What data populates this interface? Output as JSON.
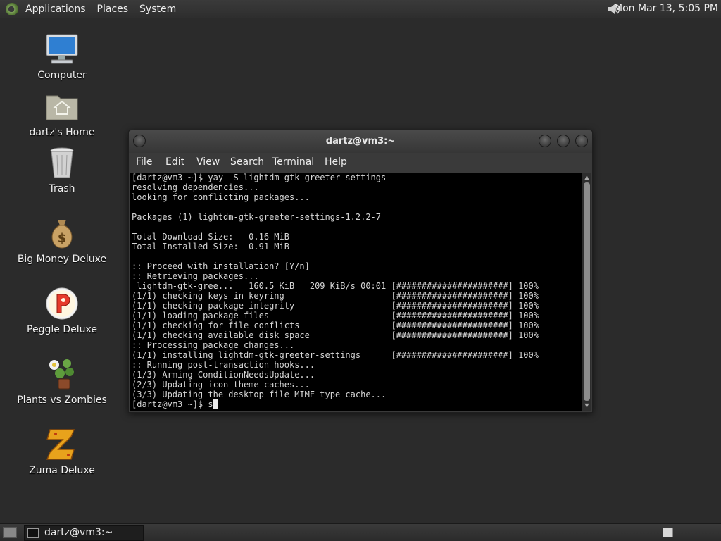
{
  "top_panel": {
    "menus": [
      "Applications",
      "Places",
      "System"
    ],
    "clock": "Mon Mar 13,  5:05 PM",
    "icons": {
      "logo": "app-menu-logo-icon",
      "volume": "volume-icon"
    }
  },
  "desktop": {
    "icons": [
      {
        "label": "Computer",
        "icon": "computer-icon"
      },
      {
        "label": "dartz's Home",
        "icon": "home-folder-icon"
      },
      {
        "label": "Trash",
        "icon": "trash-icon"
      },
      {
        "label": "Big Money Deluxe",
        "icon": "money-bag-icon"
      },
      {
        "label": "Peggle Deluxe",
        "icon": "peggle-icon"
      },
      {
        "label": "Plants vs Zombies",
        "icon": "plant-icon"
      },
      {
        "label": "Zuma Deluxe",
        "icon": "zuma-icon"
      }
    ]
  },
  "terminal": {
    "title": "dartz@vm3:~",
    "menu": [
      "File",
      "Edit",
      "View",
      "Search",
      "Terminal",
      "Help"
    ],
    "lines": [
      "[dartz@vm3 ~]$ yay -S lightdm-gtk-greeter-settings",
      "resolving dependencies...",
      "looking for conflicting packages...",
      "",
      "Packages (1) lightdm-gtk-greeter-settings-1.2.2-7",
      "",
      "Total Download Size:   0.16 MiB",
      "Total Installed Size:  0.91 MiB",
      "",
      ":: Proceed with installation? [Y/n]",
      ":: Retrieving packages...",
      " lightdm-gtk-gree...   160.5 KiB   209 KiB/s 00:01 [######################] 100%",
      "(1/1) checking keys in keyring                     [######################] 100%",
      "(1/1) checking package integrity                   [######################] 100%",
      "(1/1) loading package files                        [######################] 100%",
      "(1/1) checking for file conflicts                  [######################] 100%",
      "(1/1) checking available disk space                [######################] 100%",
      ":: Processing package changes...",
      "(1/1) installing lightdm-gtk-greeter-settings      [######################] 100%",
      ":: Running post-transaction hooks...",
      "(1/3) Arming ConditionNeedsUpdate...",
      "(2/3) Updating icon theme caches...",
      "(3/3) Updating the desktop file MIME type cache..."
    ],
    "prompt": "[dartz@vm3 ~]$ s"
  },
  "bottom_panel": {
    "task": "dartz@vm3:~"
  }
}
